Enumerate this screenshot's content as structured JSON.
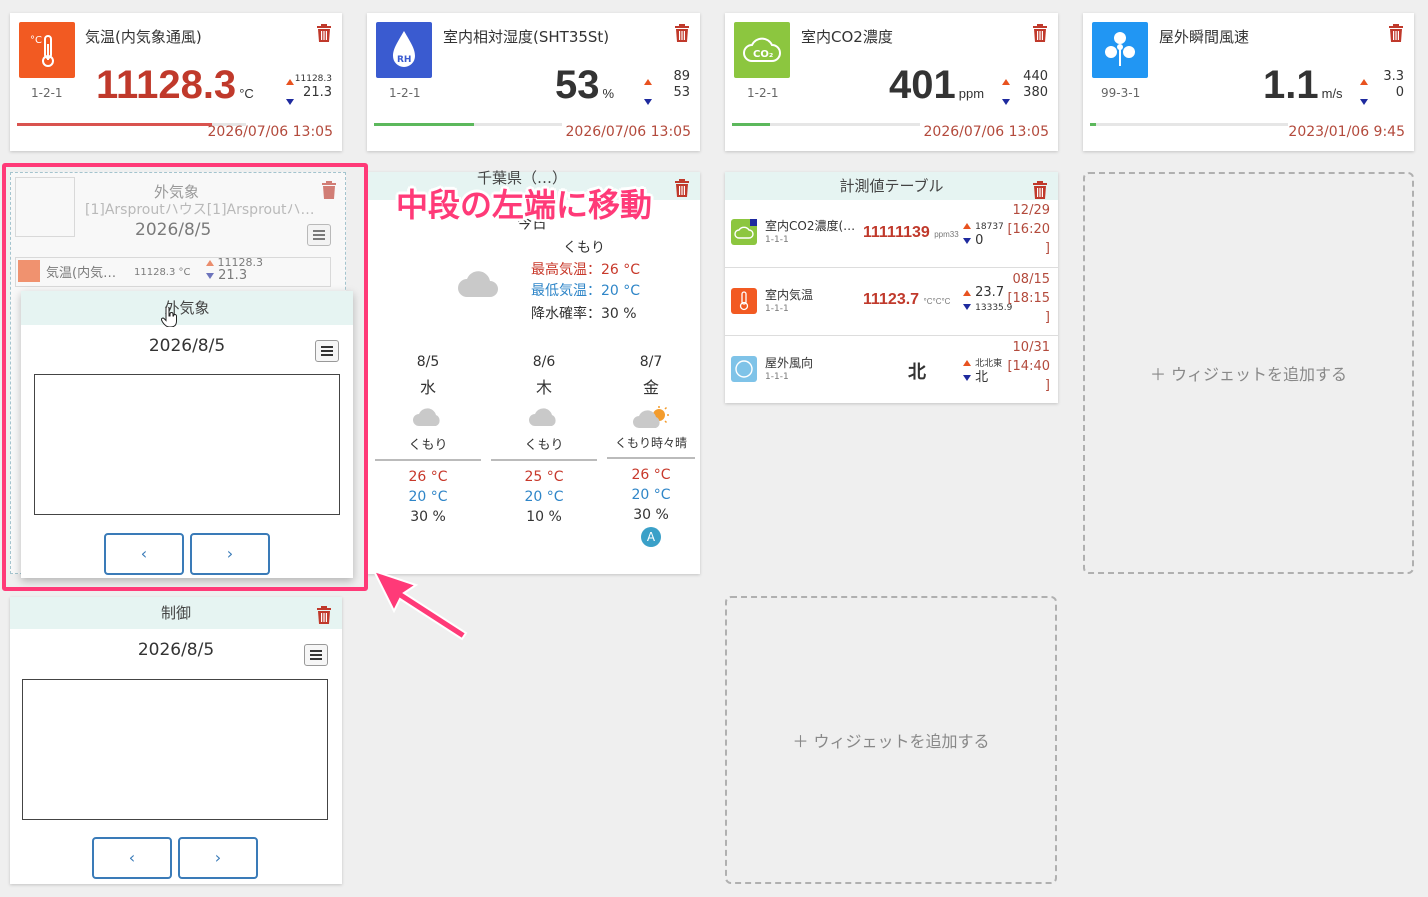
{
  "cards": [
    {
      "title": "気温(内気象通風)",
      "code": "1-2-1",
      "value": "11128.3",
      "unit": "°C",
      "high": "11128.3",
      "low": "21.3",
      "date": "2026/07/06 13:05",
      "progress": 0.85,
      "bar_color": "#d9534f",
      "icon": "thermometer-icon",
      "icon_color": "#f25a22"
    },
    {
      "title": "室内相対湿度(SHT35St)",
      "code": "1-2-1",
      "value": "53",
      "unit": "%",
      "high": "89",
      "low": "53",
      "date": "2026/07/06 13:05",
      "progress": 0.53,
      "bar_color": "#5cb85c",
      "icon": "humidity-rh-icon",
      "icon_color": "#3a5bd0",
      "icon_text": "RH"
    },
    {
      "title": "室内CO2濃度",
      "code": "1-2-1",
      "value": "401",
      "unit": "ppm",
      "high": "440",
      "low": "380",
      "date": "2026/07/06 13:05",
      "progress": 0.2,
      "bar_color": "#5cb85c",
      "icon": "co2-icon",
      "icon_color": "#8cc63f",
      "icon_text": "CO₂"
    },
    {
      "title": "屋外瞬間風速",
      "code": "99-3-1",
      "value": "1.1",
      "unit": "m/s",
      "high": "3.3",
      "low": "0",
      "date": "2023/01/06 9:45",
      "progress": 0.03,
      "bar_color": "#5cb85c",
      "icon": "wind-fan-icon",
      "icon_color": "#2196f3"
    }
  ],
  "drag_ghost": {
    "title": "外気象",
    "subtitle": "[1]Arsproutハウス[1]Arsproutハ…",
    "date": "2026/8/5",
    "row_label": "気温(内気…",
    "row_value": "11128.3 °C",
    "row_high": "11128.3",
    "row_low": "21.3"
  },
  "dragged_widget": {
    "title": "外気象",
    "date": "2026/8/5",
    "prev": "‹",
    "next": "›"
  },
  "control_widget": {
    "title": "制御",
    "date": "2026/8/5",
    "prev": "‹",
    "next": "›"
  },
  "weather": {
    "location": "千葉県（…）",
    "today_label": "今日",
    "condition": "くもり",
    "max_label": "最高気温：26 °C",
    "min_label": "最低気温：20 °C",
    "rain_label": "降水確率：30 %",
    "days": [
      {
        "date": "8/5",
        "weekday": "水",
        "condition": "くもり",
        "max": "26 °C",
        "min": "20 °C",
        "rain": "30 %"
      },
      {
        "date": "8/6",
        "weekday": "木",
        "condition": "くもり",
        "max": "25 °C",
        "min": "20 °C",
        "rain": "10 %"
      },
      {
        "date": "8/7",
        "weekday": "金",
        "condition": "くもり時々晴",
        "max": "26 °C",
        "min": "20 °C",
        "rain": "30 %"
      }
    ],
    "badge": "A"
  },
  "measure_table": {
    "title": "計測値テーブル",
    "rows": [
      {
        "name": "室内CO2濃度(…",
        "code": "1-1-1",
        "value": "11111139",
        "unit": "ppm33",
        "high": "18737",
        "low": "0",
        "time": [
          "12/29",
          "[16:20",
          "]"
        ],
        "icon": "co2-icon",
        "icon_color": "#8cc63f"
      },
      {
        "name": "室内気温",
        "code": "1-1-1",
        "value": "11123.7",
        "unit": "°C°C°C",
        "high": "23.7",
        "low": "13335.9",
        "time": [
          "08/15",
          "[18:15",
          "]"
        ],
        "icon": "thermometer-icon",
        "icon_color": "#f25a22"
      },
      {
        "name": "屋外風向",
        "code": "1-1-1",
        "value": "北",
        "unit": "",
        "high": "北北東",
        "low": "北",
        "time": [
          "10/31",
          "[14:40",
          "]"
        ],
        "icon": "compass-icon",
        "icon_color": "#7fc3e8"
      }
    ]
  },
  "add_widget_label": "＋ ウィジェットを追加する",
  "annotation": {
    "text": "中段の左端に移動",
    "color": "#ff3a78"
  }
}
